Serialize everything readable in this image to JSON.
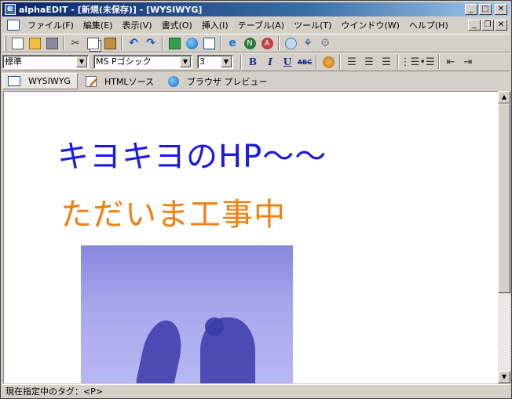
{
  "window": {
    "title": "alphaEDIT - [新規(未保存)] - [WYSIWYG]",
    "minimize_glyph": "_",
    "maximize_glyph": "□",
    "close_glyph": "✕",
    "restore_glyph": "❐"
  },
  "menu": {
    "items": [
      "ファイル(F)",
      "編集(E)",
      "表示(V)",
      "書式(O)",
      "挿入(I)",
      "テーブル(A)",
      "ツール(T)",
      "ウインドウ(W)",
      "ヘルプ(H)"
    ]
  },
  "format_bar": {
    "style_value": "標準",
    "font_value": "MS Pゴシック",
    "size_value": "3",
    "bold": "B",
    "italic": "I",
    "underline": "U",
    "strike": "ABC"
  },
  "tabs": [
    {
      "label": "WYSIWYG",
      "active": true
    },
    {
      "label": "HTMLソース",
      "active": false
    },
    {
      "label": "ブラウザ プレビュー",
      "active": false
    }
  ],
  "document": {
    "heading": "キヨキヨのHP～～",
    "subheading": "ただいま工事中",
    "heading_color": "#1a1ae0",
    "subheading_color": "#f08010"
  },
  "status": {
    "text": "現在指定中のタグ：<P>"
  },
  "icons": [
    "new-icon",
    "open-icon",
    "save-icon",
    "cut-icon",
    "copy-icon",
    "paste-icon",
    "undo-icon",
    "redo-icon",
    "ie-icon",
    "netscape-icon",
    "css-icon",
    "gear-icon"
  ]
}
